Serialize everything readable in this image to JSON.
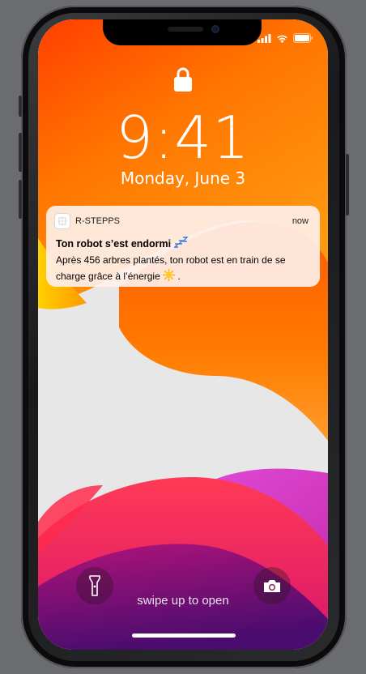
{
  "lockscreen": {
    "time": "9:41",
    "date": "Monday, June 3",
    "swipe_hint": "swipe up to open"
  },
  "notification": {
    "app_name": "R-STEPPS",
    "time": "now",
    "title": "Ton robot s’est endormi",
    "title_emoji": "zzz",
    "body": "Après 456 arbres plantés, ton robot est en train de se charge grâce à l’énergie",
    "body_emoji": "sun",
    "body_end": "."
  },
  "icons": {
    "lock": "lock-icon",
    "flashlight": "flashlight-icon",
    "camera": "camera-icon",
    "signal": "cellular-signal-icon",
    "wifi": "wifi-icon",
    "battery": "battery-icon"
  },
  "colors": {
    "notification_bg": "#ffefe8",
    "wallpaper_orange": "#ff7a00",
    "wallpaper_magenta": "#e0197a",
    "wallpaper_purple": "#5a0f73"
  }
}
